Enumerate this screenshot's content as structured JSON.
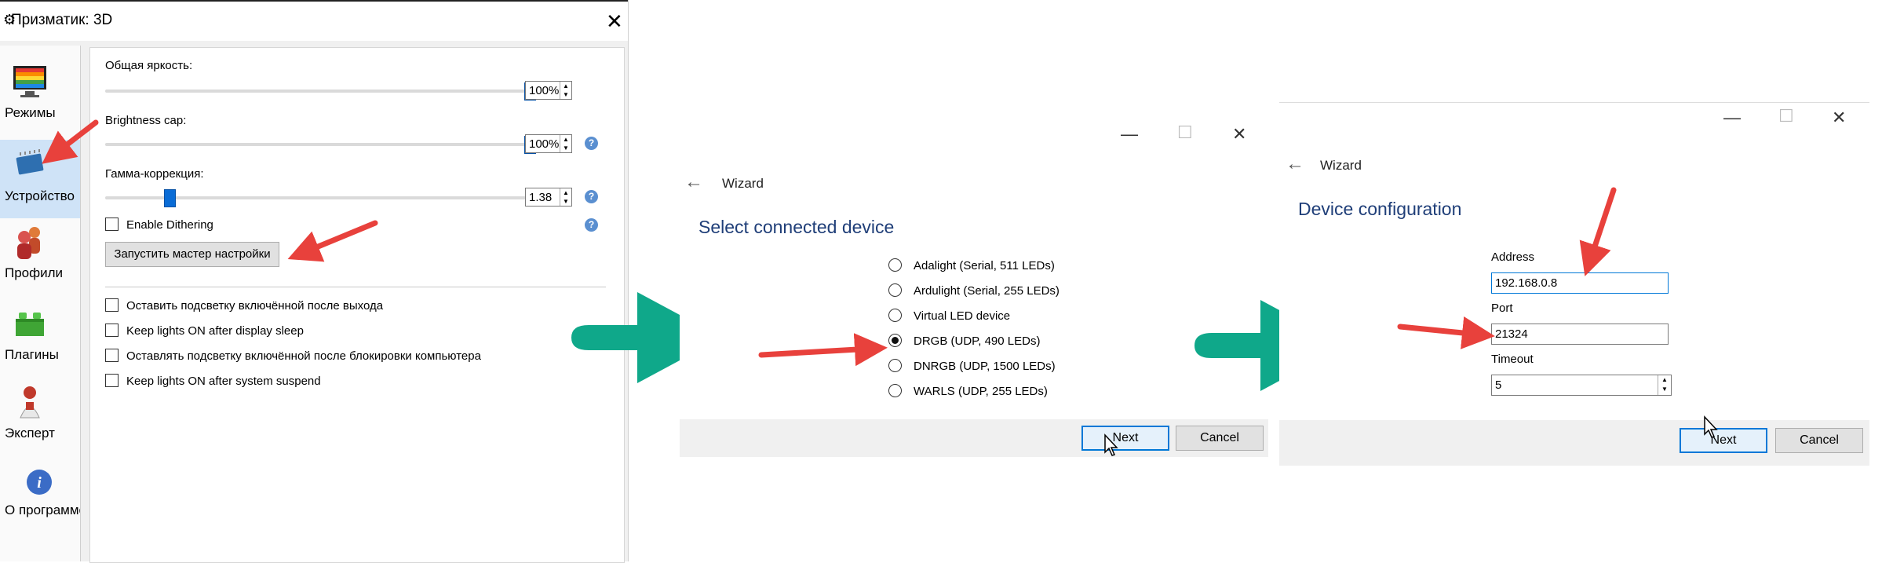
{
  "settings_window": {
    "title": "Призматик: 3D",
    "close_glyph": "✕",
    "sidebar": [
      {
        "label": "Режимы",
        "icon": "monitor-rainbow-icon"
      },
      {
        "label": "Устройство",
        "icon": "chip-icon",
        "selected": true
      },
      {
        "label": "Профили",
        "icon": "profiles-people-icon"
      },
      {
        "label": "Плагины",
        "icon": "lego-brick-icon"
      },
      {
        "label": "Эксперт",
        "icon": "expert-figure-icon"
      },
      {
        "label": "О программе",
        "icon": "info-icon"
      }
    ],
    "brightness": {
      "label": "Общая яркость:",
      "value": "100%",
      "slider_percent": 100
    },
    "brightness_cap": {
      "label": "Brightness cap:",
      "value": "100%",
      "slider_percent": 100
    },
    "gamma": {
      "label": "Гамма-коррекция:",
      "value": "1.38",
      "slider_percent": 14
    },
    "dithering": {
      "label": "Enable Dithering",
      "checked": false
    },
    "wizard_button": "Запустить мастер настройки",
    "options": [
      {
        "label": "Оставить подсветку включённой после выхода",
        "checked": false
      },
      {
        "label": "Keep lights ON after display sleep",
        "checked": false
      },
      {
        "label": "Оставлять подсветку включённой после блокировки компьютера",
        "checked": false
      },
      {
        "label": "Keep lights ON after system suspend",
        "checked": false
      }
    ],
    "help_glyph": "?"
  },
  "wizard_select": {
    "header": "Wizard",
    "title": "Select connected device",
    "devices": [
      {
        "label": "Adalight (Serial, 511 LEDs)",
        "selected": false
      },
      {
        "label": "Ardulight (Serial, 255 LEDs)",
        "selected": false
      },
      {
        "label": "Virtual LED device",
        "selected": false
      },
      {
        "label": "DRGB (UDP, 490 LEDs)",
        "selected": true
      },
      {
        "label": "DNRGB (UDP, 1500 LEDs)",
        "selected": false
      },
      {
        "label": "WARLS (UDP, 255 LEDs)",
        "selected": false
      }
    ],
    "next": "Next",
    "cancel": "Cancel"
  },
  "wizard_config": {
    "header": "Wizard",
    "title": "Device configuration",
    "address_label": "Address",
    "address_value": "192.168.0.8",
    "port_label": "Port",
    "port_value": "21324",
    "timeout_label": "Timeout",
    "timeout_value": "5",
    "next": "Next",
    "cancel": "Cancel"
  },
  "window_controls": {
    "minimize": "—",
    "maximize": "☐",
    "close": "✕"
  },
  "colors": {
    "arrow_red": "#e8413c",
    "flow_arrow_green": "#0fa88a",
    "title_blue": "#1f3e78",
    "accent_blue": "#0078d7"
  }
}
